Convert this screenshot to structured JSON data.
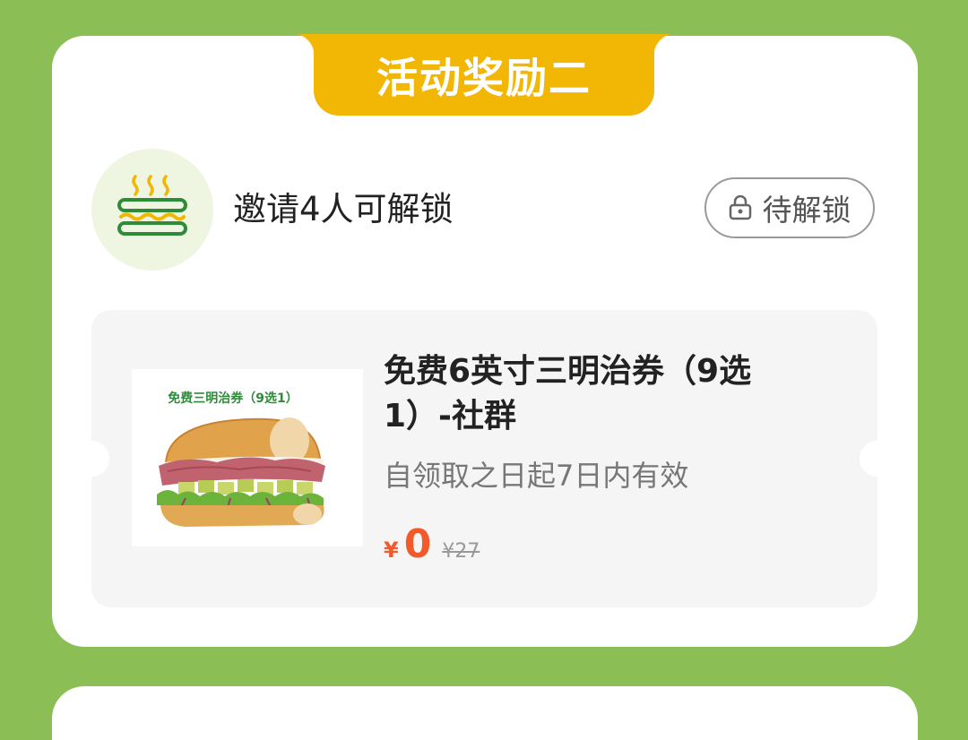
{
  "banner": {
    "title": "活动奖励二"
  },
  "reward": {
    "condition_text": "邀请4人可解锁",
    "icon": "sandwich-icon",
    "lock_button_label": "待解锁",
    "lock_icon": "lock-icon"
  },
  "coupon": {
    "image_caption": "免费三明治券（9选1）",
    "title": "免费6英寸三明治券（9选1）-社群",
    "validity": "自领取之日起7日内有效",
    "currency_symbol": "¥",
    "price": "0",
    "original_price": "¥27"
  },
  "colors": {
    "background": "#8bbf55",
    "banner": "#f2b705",
    "accent_price": "#f25a2a",
    "icon_green": "#2e8b3a",
    "icon_yellow": "#f2b705"
  }
}
